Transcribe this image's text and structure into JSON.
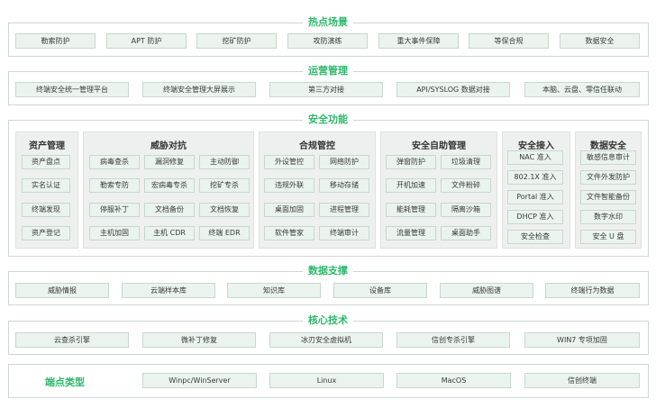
{
  "hot": {
    "title": "热点场景",
    "items": [
      "勒索防护",
      "APT 防护",
      "挖矿防护",
      "攻防演练",
      "重大事件保障",
      "等保合规",
      "数据安全"
    ]
  },
  "ops": {
    "title": "运营管理",
    "items": [
      "终端安全统一管理平台",
      "终端安全管理大屏展示",
      "第三方对接",
      "API/SYSLOG 数据对接",
      "本脑、云盘、零信任联动"
    ]
  },
  "security": {
    "title": "安全功能",
    "asset": {
      "title": "资产管理",
      "items": [
        "资产盘点",
        "实名认证",
        "终端发现",
        "资产登记"
      ]
    },
    "threat": {
      "title": "威胁对抗",
      "items": [
        "病毒查杀",
        "漏洞修复",
        "主动防御",
        "勒索专防",
        "宏病毒专杀",
        "挖矿专杀",
        "停服补丁",
        "文档备份",
        "文档恢复",
        "主机加固",
        "主机 CDR",
        "终端 EDR"
      ]
    },
    "compliance": {
      "title": "合规管控",
      "items": [
        "外设管控",
        "网络防护",
        "违规外联",
        "移动存储",
        "桌面加固",
        "进程管理",
        "软件管家",
        "终端审计"
      ]
    },
    "selfhelp": {
      "title": "安全自助管理",
      "items": [
        "弹窗防护",
        "垃圾清理",
        "开机加速",
        "文件粉碎",
        "能耗管理",
        "隔离沙箱",
        "流量管理",
        "桌面助手"
      ]
    },
    "access": {
      "title": "安全接入",
      "items": [
        "NAC 准入",
        "802.1X 准入",
        "Portal 准入",
        "DHCP 准入",
        "安全检查"
      ]
    },
    "data": {
      "title": "数据安全",
      "items": [
        "敏感信息审计",
        "文件外发防护",
        "文件智能备份",
        "数字水印",
        "安全 U 盘"
      ]
    }
  },
  "datasupport": {
    "title": "数据支撑",
    "items": [
      "威胁情报",
      "云端样本库",
      "知识库",
      "设备库",
      "威胁图谱",
      "终端行为数据"
    ]
  },
  "core": {
    "title": "核心技术",
    "items": [
      "云查杀引擎",
      "微补丁修复",
      "冰刃安全虚拟机",
      "信创专杀引擎",
      "WIN7 专项加固"
    ]
  },
  "endpoint": {
    "label": "端点类型",
    "items": [
      "Winpc/WinServer",
      "Linux",
      "MacOS",
      "信创终端"
    ]
  },
  "colors": {
    "accent": "#2db86a",
    "chip_bg": "#eaf3ee",
    "box_bg": "#eef0ef",
    "border": "#cfd6d2"
  }
}
